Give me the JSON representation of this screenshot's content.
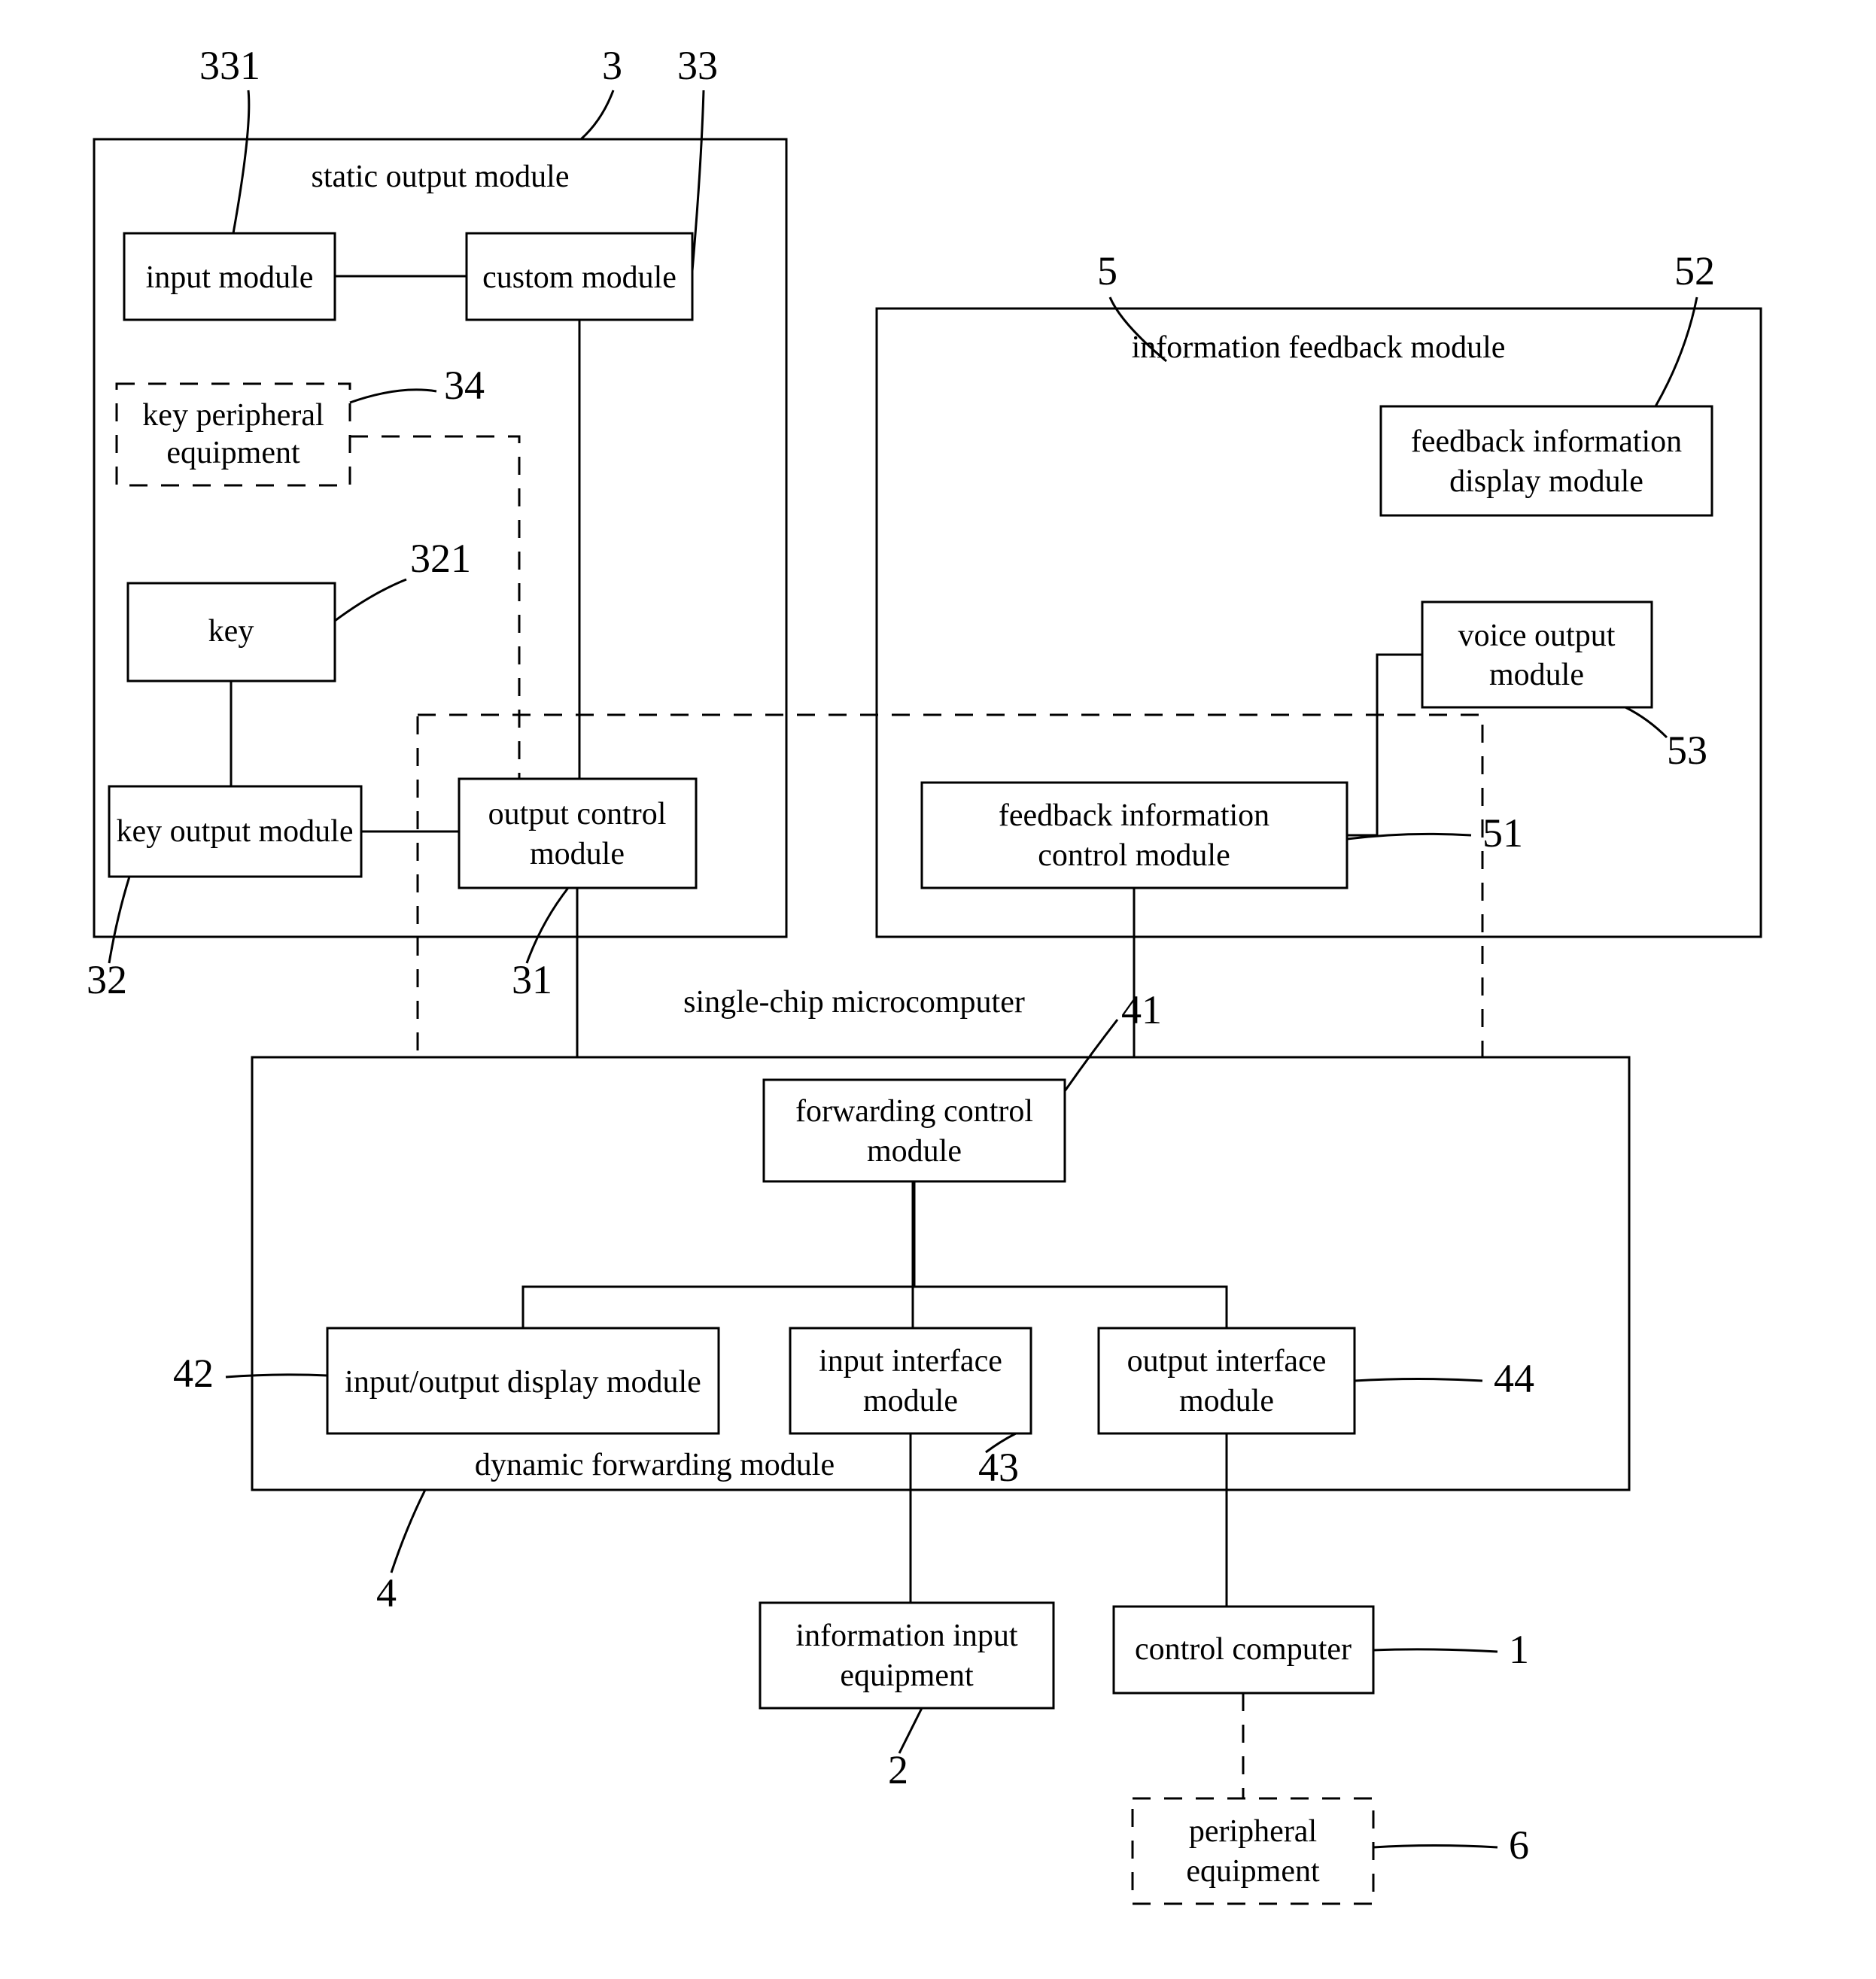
{
  "blocks": {
    "static_output_module": "static output module",
    "input_module": "input module",
    "custom_module": "custom module",
    "key_peripheral_equipment": "key peripheral equipment",
    "key": "key",
    "key_output_module": "key output module",
    "output_control_module": "output control module",
    "information_feedback_module": "information feedback module",
    "feedback_information_display_module": "feedback information display module",
    "voice_output_module": "voice output module",
    "feedback_information_control_module": "feedback information control module",
    "single_chip_microcomputer": "single-chip microcomputer",
    "forwarding_control_module": "forwarding control module",
    "input_output_display_module": "input/output display module",
    "input_interface_module": "input interface module",
    "output_interface_module": "output interface module",
    "dynamic_forwarding_module": "dynamic forwarding module",
    "information_input_equipment": "information input equipment",
    "control_computer": "control computer",
    "peripheral_equipment": "peripheral equipment"
  },
  "refs": {
    "r331": "331",
    "r3": "3",
    "r33": "33",
    "r34": "34",
    "r321": "321",
    "r32": "32",
    "r31": "31",
    "r5": "5",
    "r52": "52",
    "r53": "53",
    "r51": "51",
    "r41": "41",
    "r42": "42",
    "r43": "43",
    "r44": "44",
    "r4": "4",
    "r2": "2",
    "r1": "1",
    "r6": "6"
  }
}
